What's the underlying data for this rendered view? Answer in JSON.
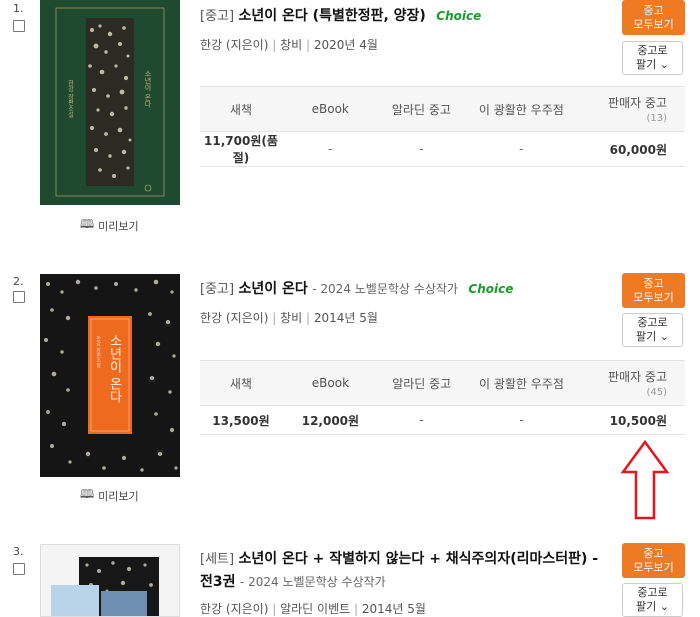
{
  "columns": [
    "새책",
    "eBook",
    "알라딘 중고",
    "이 광활한 우주점",
    "판매자 중고"
  ],
  "preview_label": "미리보기",
  "btn_all_line1": "중고",
  "btn_all_line2": "모두보기",
  "btn_sell_line1": "중고로",
  "btn_sell_line2": "팔기",
  "items": [
    {
      "number": "1.",
      "category": "[중고]",
      "title": "소년이 온다 (특별한정판, 양장)",
      "subtitle": "",
      "choice": "Choice",
      "author": "한강 (지은이)",
      "publisher": "창비",
      "date": "2020년 4월",
      "seller_count": "(13)",
      "prices": [
        "11,700원(품절)",
        "-",
        "-",
        "-",
        "60,000원"
      ],
      "cover_color": "#1f4a2f"
    },
    {
      "number": "2.",
      "category": "[중고]",
      "title": "소년이 온다",
      "subtitle": "- 2024 노벨문학상 수상작가",
      "choice": "Choice",
      "author": "한강 (지은이)",
      "publisher": "창비",
      "date": "2014년 5월",
      "seller_count": "(45)",
      "prices": [
        "13,500원",
        "12,000원",
        "-",
        "-",
        "10,500원"
      ],
      "cover_color": "#151515",
      "cover_title": "소년이 온다"
    },
    {
      "number": "3.",
      "category": "[세트]",
      "title": "소년이 온다 + 작별하지 않는다 + 채식주의자(리마스터판) - 전3권",
      "subtitle": "- 2024 노벨문학상 수상작가",
      "author": "한강 (지은이)",
      "publisher": "알라딘 이벤트",
      "date": "2014년 5월"
    }
  ],
  "colors": {
    "accent": "#ee7a23",
    "choice": "#1a9a2a",
    "arrow": "#e8141b"
  }
}
